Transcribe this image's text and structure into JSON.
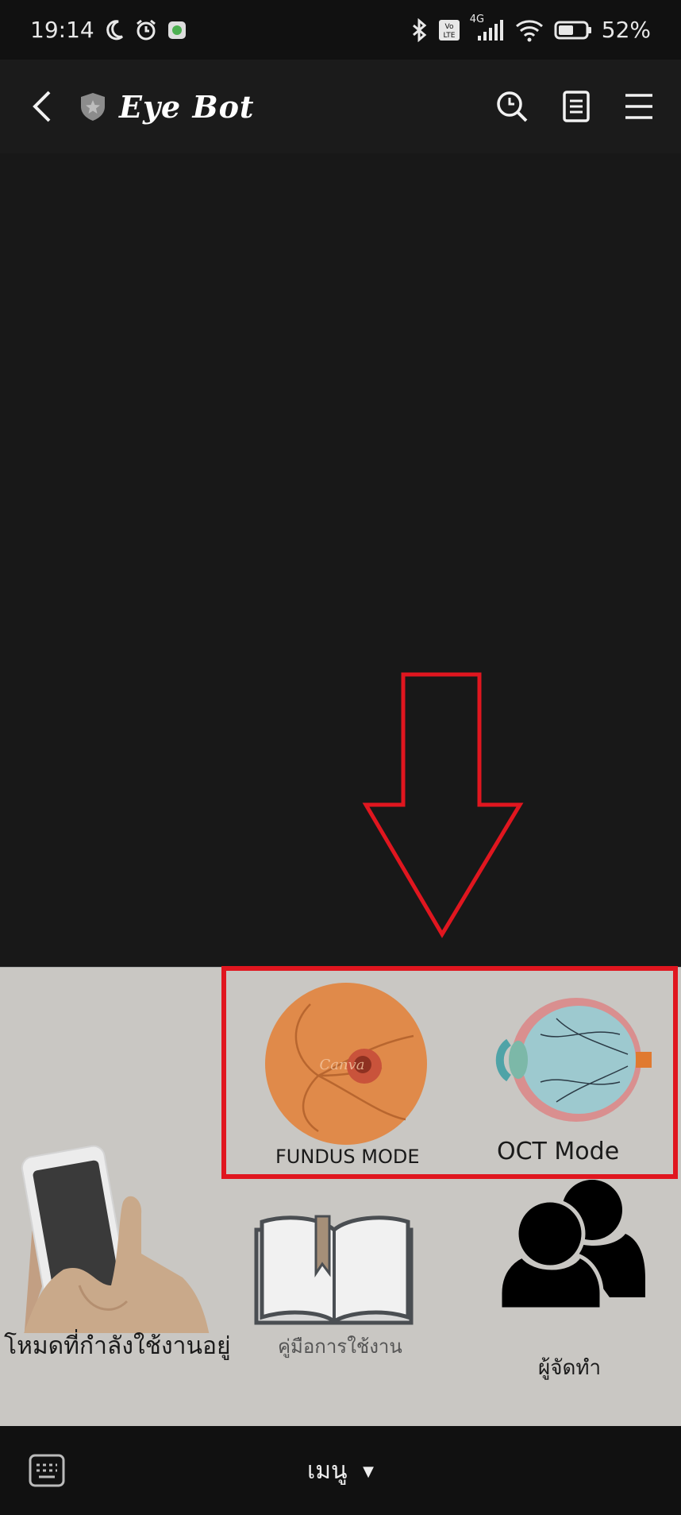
{
  "status_bar": {
    "time": "19:14",
    "network": "4G",
    "volte": "Vo LTE",
    "battery": "52%"
  },
  "app_bar": {
    "title": "Eye Bot"
  },
  "rich_menu": {
    "fundus_label": "FUNDUS MODE",
    "oct_label": "OCT Mode",
    "current_mode_label": "โหมดที่กำลังใช้งานอยู่",
    "manual_label": "คู่มือการใช้งาน",
    "creators_label": "ผู้จัดทำ",
    "watermark": "Canva"
  },
  "bottom_bar": {
    "menu_label": "เมนู"
  },
  "colors": {
    "highlight": "#e0161f",
    "menu_bg": "#c9c7c3",
    "fundus": "#e08a4a"
  }
}
